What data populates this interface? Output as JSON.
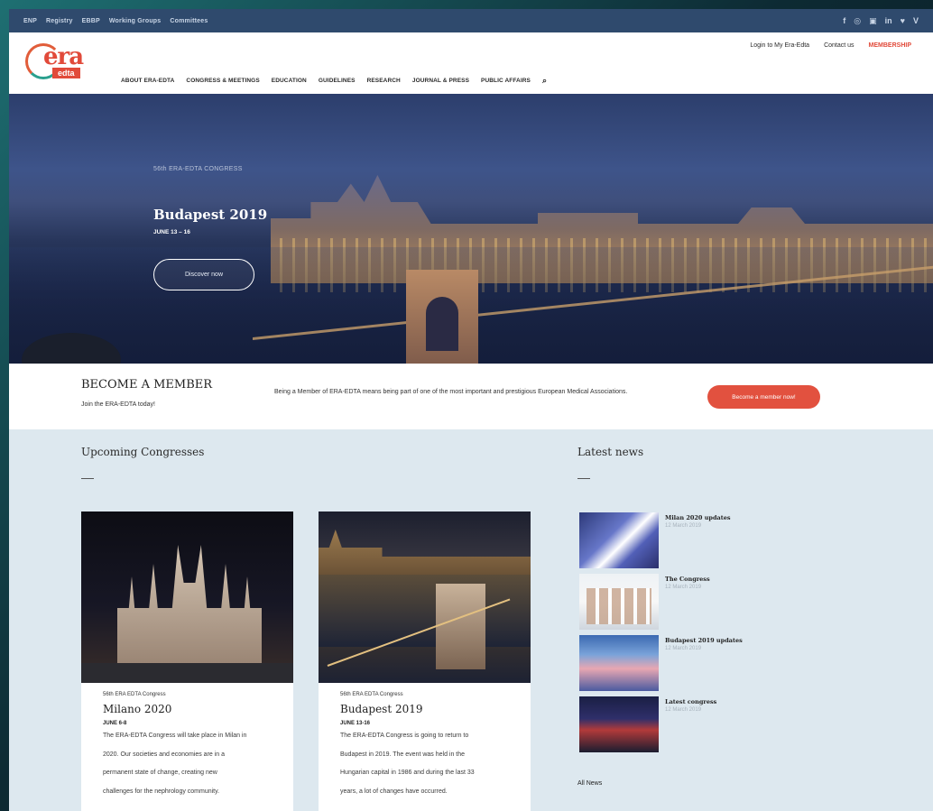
{
  "topbar": {
    "links": [
      "ENP",
      "Registry",
      "EBBP",
      "Working Groups",
      "Committees"
    ],
    "social": [
      "f",
      "◎",
      "▣",
      "in",
      "♥",
      "V"
    ]
  },
  "header": {
    "logo_text": "era",
    "logo_sub": "edta",
    "nav": [
      "ABOUT ERA-EDTA",
      "CONGRESS & MEETINGS",
      "EDUCATION",
      "GUIDELINES",
      "RESEARCH",
      "JOURNAL & PRESS",
      "PUBLIC AFFAIRS"
    ],
    "search_icon": "⌕",
    "right_links": [
      "Login to My Era-Edta",
      "Contact us",
      "MEMBERSHIP"
    ]
  },
  "hero": {
    "eyebrow": "56th ERA-EDTA CONGRESS",
    "title": "Budapest 2019",
    "date": "JUNE 13 – 16",
    "button": "Discover now"
  },
  "member": {
    "title": "BECOME A MEMBER",
    "subtitle": "Join the ERA-EDTA today!",
    "text": "Being a Member of ERA-EDTA means being part of one of the most important and prestigious European Medical Associations.",
    "button": "Become a member now!"
  },
  "congresses": {
    "title": "Upcoming Congresses",
    "cards": [
      {
        "eyebrow": "56th ERA EDTA Congress",
        "title": "Milano 2020",
        "date": "JUNE 6-8",
        "lines": [
          "The ERA-EDTA Congress will take place in Milan in",
          "2020. Our societies and economies are in a",
          "permanent state of change, creating new",
          "challenges for the nephrology community."
        ]
      },
      {
        "eyebrow": "56th ERA EDTA Congress",
        "title": "Budapest 2019",
        "date": "JUNE 13-16",
        "lines": [
          "The ERA-EDTA Congress is going to return to",
          "Budapest in 2019. The event was held in the",
          "Hungarian capital in 1986 and during the last 33",
          "years, a lot of changes have occurred."
        ]
      }
    ]
  },
  "news": {
    "title": "Latest news",
    "items": [
      {
        "title": "Milan 2020 updates",
        "date": "12 March 2019"
      },
      {
        "title": "The Congress",
        "date": "12 March 2019"
      },
      {
        "title": "Budapest 2019 updates",
        "date": "12 March 2019"
      },
      {
        "title": "Latest congress",
        "date": "12 March 2019"
      }
    ],
    "all_link": "All News"
  }
}
